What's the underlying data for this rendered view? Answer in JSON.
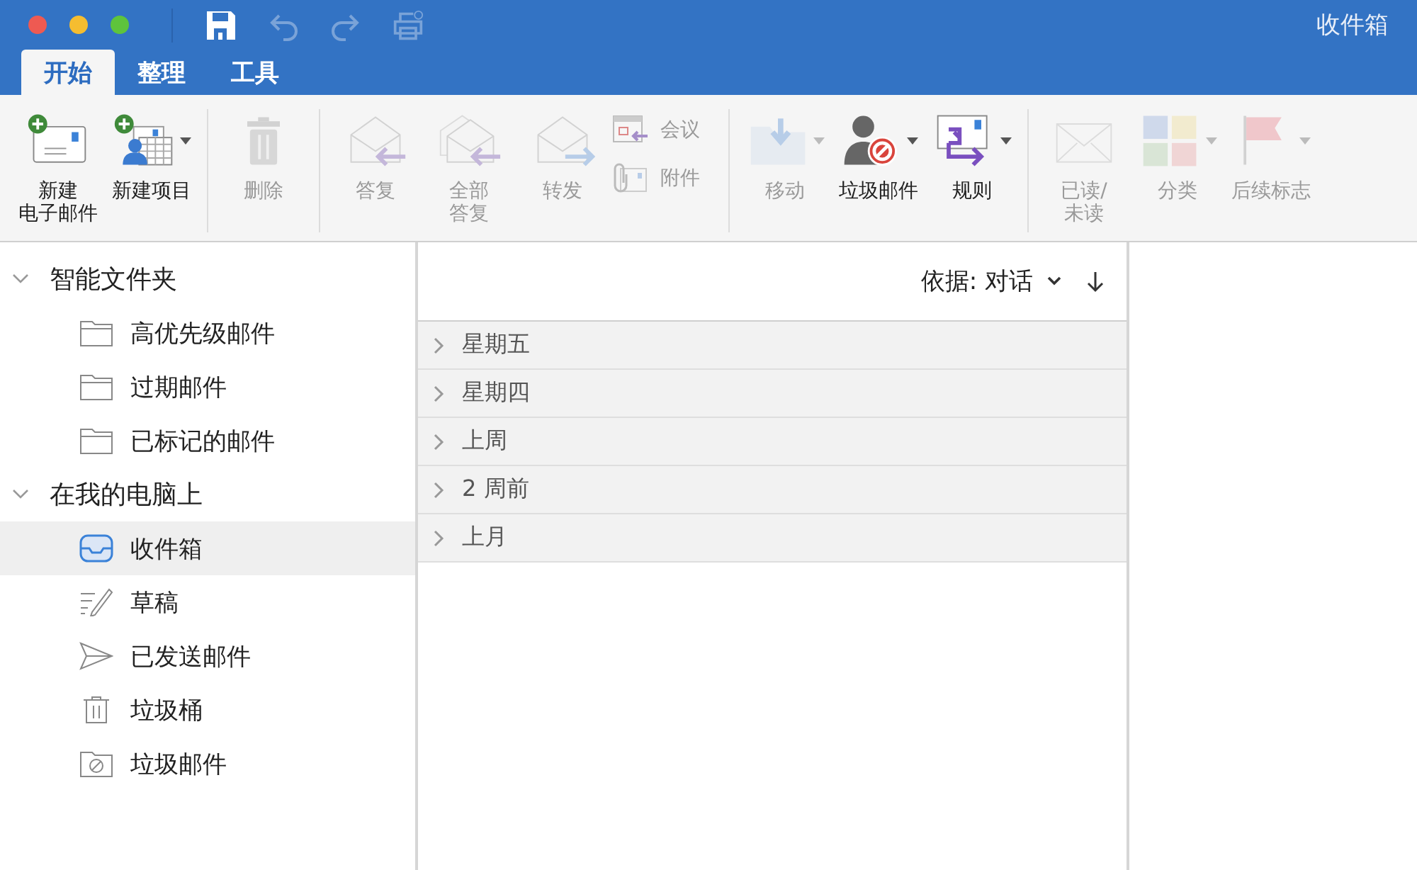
{
  "window": {
    "title": "收件箱"
  },
  "quick_access": [
    {
      "kind": "save",
      "disabled": false
    },
    {
      "kind": "undo",
      "disabled": true
    },
    {
      "kind": "redo",
      "disabled": true
    },
    {
      "kind": "print",
      "disabled": true
    }
  ],
  "tabs": [
    {
      "label": "开始",
      "selected": true
    },
    {
      "label": "整理",
      "selected": false
    },
    {
      "label": "工具",
      "selected": false
    }
  ],
  "ribbon": [
    {
      "items": [
        {
          "kind": "newmail",
          "label": [
            "新建",
            "电子邮件"
          ],
          "disabled": false
        },
        {
          "kind": "newitem",
          "label": [
            "新建项目"
          ],
          "disabled": false,
          "menu": true
        }
      ]
    },
    {
      "items": [
        {
          "kind": "delete",
          "label": [
            "删除"
          ],
          "disabled": true
        }
      ]
    },
    {
      "items": [
        {
          "kind": "reply",
          "label": [
            "答复"
          ],
          "disabled": true
        },
        {
          "kind": "replyall",
          "label": [
            "全部",
            "答复"
          ],
          "disabled": true
        },
        {
          "kind": "forward",
          "label": [
            "转发"
          ],
          "disabled": true
        },
        {
          "kind": "meeting",
          "label": [
            "会议"
          ],
          "disabled": true
        },
        {
          "kind": "attachment",
          "label": [
            "附件"
          ],
          "disabled": true
        }
      ]
    },
    {
      "items": [
        {
          "kind": "move",
          "label": [
            "移动"
          ],
          "disabled": true,
          "menu": true
        },
        {
          "kind": "junk",
          "label": [
            "垃圾邮件"
          ],
          "disabled": false,
          "menu": true
        },
        {
          "kind": "rules",
          "label": [
            "规则"
          ],
          "disabled": false,
          "menu": true
        }
      ]
    },
    {
      "items": [
        {
          "kind": "read",
          "label": [
            "已读/",
            "未读"
          ],
          "disabled": true
        },
        {
          "kind": "categorize",
          "label": [
            "分类"
          ],
          "disabled": true,
          "menu": true
        },
        {
          "kind": "flag",
          "label": [
            "后续标志"
          ],
          "disabled": true,
          "menu": true
        }
      ]
    }
  ],
  "sidebar": [
    {
      "label": "智能文件夹",
      "expanded": true,
      "children": [
        {
          "label": "高优先级邮件",
          "kind": "folder",
          "selected": false
        },
        {
          "label": "过期邮件",
          "kind": "folder",
          "selected": false
        },
        {
          "label": "已标记的邮件",
          "kind": "folder",
          "selected": false
        }
      ]
    },
    {
      "label": "在我的电脑上",
      "expanded": true,
      "children": [
        {
          "label": "收件箱",
          "kind": "inbox",
          "selected": true
        },
        {
          "label": "草稿",
          "kind": "drafts",
          "selected": false
        },
        {
          "label": "已发送邮件",
          "kind": "sent",
          "selected": false
        },
        {
          "label": "垃圾桶",
          "kind": "trash",
          "selected": false
        },
        {
          "label": "垃圾邮件",
          "kind": "junk",
          "selected": false
        }
      ]
    }
  ],
  "message_list": {
    "sort": "依据: 对话",
    "groups": [
      {
        "label": "星期五",
        "expanded": false
      },
      {
        "label": "星期四",
        "expanded": false
      },
      {
        "label": "上周",
        "expanded": false
      },
      {
        "label": "2 周前",
        "expanded": false
      },
      {
        "label": "上月",
        "expanded": false
      }
    ]
  }
}
